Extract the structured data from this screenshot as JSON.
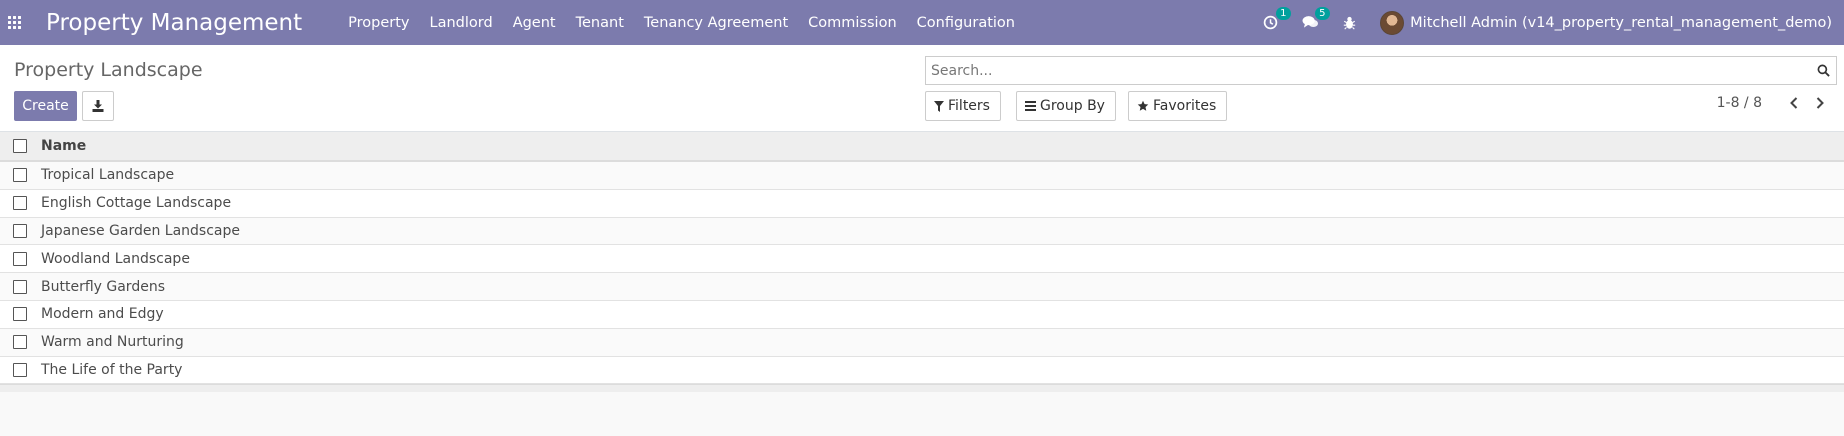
{
  "navbar": {
    "brand": "Property Management",
    "menu": [
      "Property",
      "Landlord",
      "Agent",
      "Tenant",
      "Tenancy Agreement",
      "Commission",
      "Configuration"
    ],
    "activity_count": "1",
    "messages_count": "5",
    "user_name": "Mitchell Admin (v14_property_rental_management_demo)"
  },
  "control": {
    "title": "Property Landscape",
    "create_label": "Create",
    "search_placeholder": "Search...",
    "filters_label": "Filters",
    "groupby_label": "Group By",
    "favorites_label": "Favorites",
    "pager": "1-8 / 8"
  },
  "list": {
    "column_name": "Name",
    "rows": [
      "Tropical Landscape",
      "English Cottage Landscape",
      "Japanese Garden Landscape",
      "Woodland Landscape",
      "Butterfly Gardens",
      "Modern and Edgy",
      "Warm and Nurturing",
      "The Life of the Party"
    ]
  },
  "colors": {
    "primary": "#7c7bad",
    "badge": "#00a09d"
  }
}
